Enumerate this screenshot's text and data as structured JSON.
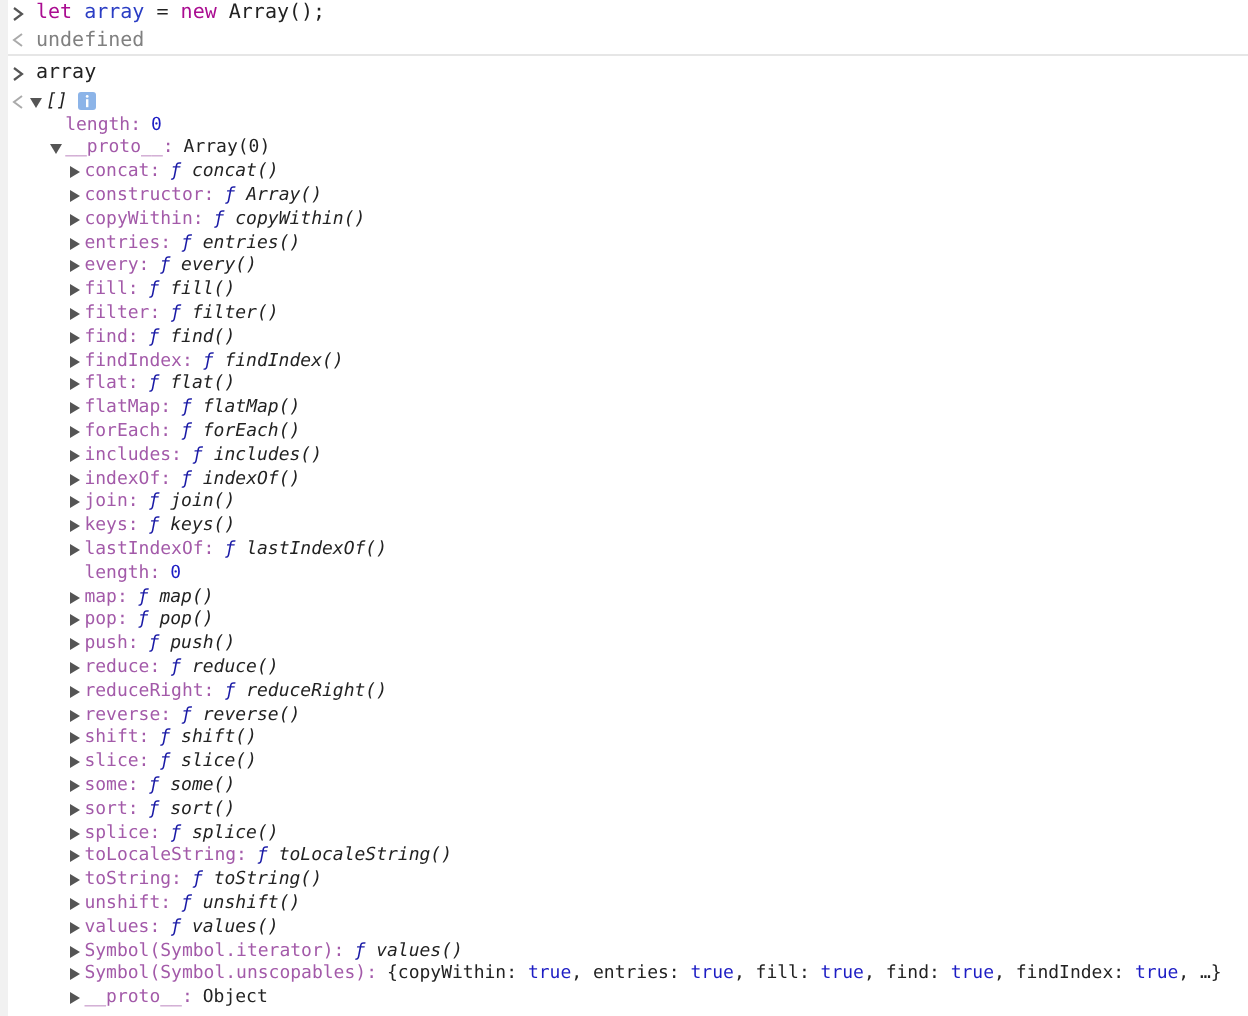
{
  "console": [
    {
      "kind": "input",
      "tokens": [
        {
          "text": "let",
          "kind": "keyword"
        },
        {
          "text": "array",
          "kind": "variable"
        },
        {
          "text": "=",
          "kind": "plain"
        },
        {
          "text": "new",
          "kind": "keyword"
        },
        {
          "text": "Array();",
          "kind": "plain"
        }
      ]
    },
    {
      "kind": "output",
      "text": "undefined"
    },
    {
      "kind": "input",
      "tokens": [
        {
          "text": "array",
          "kind": "plain"
        }
      ]
    },
    {
      "kind": "result",
      "tree": [
        {
          "kind": "array",
          "label": "[]",
          "info": true,
          "expandable": true,
          "expanded": true,
          "children": [
            {
              "key": "length:",
              "kind": "number",
              "value": "0",
              "expandable": false
            },
            {
              "key": "__proto__:",
              "kind": "object",
              "value": "Array(0)",
              "expandable": true,
              "expanded": true,
              "children": [
                {
                  "key": "concat:",
                  "kind": "function",
                  "sign": "ƒ",
                  "value": "concat()",
                  "expandable": true,
                  "expanded": false
                },
                {
                  "key": "constructor:",
                  "kind": "function",
                  "sign": "ƒ",
                  "value": "Array()",
                  "expandable": true,
                  "expanded": false
                },
                {
                  "key": "copyWithin:",
                  "kind": "function",
                  "sign": "ƒ",
                  "value": "copyWithin()",
                  "expandable": true,
                  "expanded": false
                },
                {
                  "key": "entries:",
                  "kind": "function",
                  "sign": "ƒ",
                  "value": "entries()",
                  "expandable": true,
                  "expanded": false
                },
                {
                  "key": "every:",
                  "kind": "function",
                  "sign": "ƒ",
                  "value": "every()",
                  "expandable": true,
                  "expanded": false
                },
                {
                  "key": "fill:",
                  "kind": "function",
                  "sign": "ƒ",
                  "value": "fill()",
                  "expandable": true,
                  "expanded": false
                },
                {
                  "key": "filter:",
                  "kind": "function",
                  "sign": "ƒ",
                  "value": "filter()",
                  "expandable": true,
                  "expanded": false
                },
                {
                  "key": "find:",
                  "kind": "function",
                  "sign": "ƒ",
                  "value": "find()",
                  "expandable": true,
                  "expanded": false
                },
                {
                  "key": "findIndex:",
                  "kind": "function",
                  "sign": "ƒ",
                  "value": "findIndex()",
                  "expandable": true,
                  "expanded": false
                },
                {
                  "key": "flat:",
                  "kind": "function",
                  "sign": "ƒ",
                  "value": "flat()",
                  "expandable": true,
                  "expanded": false
                },
                {
                  "key": "flatMap:",
                  "kind": "function",
                  "sign": "ƒ",
                  "value": "flatMap()",
                  "expandable": true,
                  "expanded": false
                },
                {
                  "key": "forEach:",
                  "kind": "function",
                  "sign": "ƒ",
                  "value": "forEach()",
                  "expandable": true,
                  "expanded": false
                },
                {
                  "key": "includes:",
                  "kind": "function",
                  "sign": "ƒ",
                  "value": "includes()",
                  "expandable": true,
                  "expanded": false
                },
                {
                  "key": "indexOf:",
                  "kind": "function",
                  "sign": "ƒ",
                  "value": "indexOf()",
                  "expandable": true,
                  "expanded": false
                },
                {
                  "key": "join:",
                  "kind": "function",
                  "sign": "ƒ",
                  "value": "join()",
                  "expandable": true,
                  "expanded": false
                },
                {
                  "key": "keys:",
                  "kind": "function",
                  "sign": "ƒ",
                  "value": "keys()",
                  "expandable": true,
                  "expanded": false
                },
                {
                  "key": "lastIndexOf:",
                  "kind": "function",
                  "sign": "ƒ",
                  "value": "lastIndexOf()",
                  "expandable": true,
                  "expanded": false
                },
                {
                  "key": "length:",
                  "kind": "number",
                  "value": "0",
                  "expandable": false
                },
                {
                  "key": "map:",
                  "kind": "function",
                  "sign": "ƒ",
                  "value": "map()",
                  "expandable": true,
                  "expanded": false
                },
                {
                  "key": "pop:",
                  "kind": "function",
                  "sign": "ƒ",
                  "value": "pop()",
                  "expandable": true,
                  "expanded": false
                },
                {
                  "key": "push:",
                  "kind": "function",
                  "sign": "ƒ",
                  "value": "push()",
                  "expandable": true,
                  "expanded": false
                },
                {
                  "key": "reduce:",
                  "kind": "function",
                  "sign": "ƒ",
                  "value": "reduce()",
                  "expandable": true,
                  "expanded": false
                },
                {
                  "key": "reduceRight:",
                  "kind": "function",
                  "sign": "ƒ",
                  "value": "reduceRight()",
                  "expandable": true,
                  "expanded": false
                },
                {
                  "key": "reverse:",
                  "kind": "function",
                  "sign": "ƒ",
                  "value": "reverse()",
                  "expandable": true,
                  "expanded": false
                },
                {
                  "key": "shift:",
                  "kind": "function",
                  "sign": "ƒ",
                  "value": "shift()",
                  "expandable": true,
                  "expanded": false
                },
                {
                  "key": "slice:",
                  "kind": "function",
                  "sign": "ƒ",
                  "value": "slice()",
                  "expandable": true,
                  "expanded": false
                },
                {
                  "key": "some:",
                  "kind": "function",
                  "sign": "ƒ",
                  "value": "some()",
                  "expandable": true,
                  "expanded": false
                },
                {
                  "key": "sort:",
                  "kind": "function",
                  "sign": "ƒ",
                  "value": "sort()",
                  "expandable": true,
                  "expanded": false
                },
                {
                  "key": "splice:",
                  "kind": "function",
                  "sign": "ƒ",
                  "value": "splice()",
                  "expandable": true,
                  "expanded": false
                },
                {
                  "key": "toLocaleString:",
                  "kind": "function",
                  "sign": "ƒ",
                  "value": "toLocaleString()",
                  "expandable": true,
                  "expanded": false
                },
                {
                  "key": "toString:",
                  "kind": "function",
                  "sign": "ƒ",
                  "value": "toString()",
                  "expandable": true,
                  "expanded": false
                },
                {
                  "key": "unshift:",
                  "kind": "function",
                  "sign": "ƒ",
                  "value": "unshift()",
                  "expandable": true,
                  "expanded": false
                },
                {
                  "key": "values:",
                  "kind": "function",
                  "sign": "ƒ",
                  "value": "values()",
                  "expandable": true,
                  "expanded": false
                },
                {
                  "key": "Symbol(Symbol.iterator):",
                  "kind": "function",
                  "sign": "ƒ",
                  "value": "values()",
                  "expandable": true,
                  "expanded": false
                },
                {
                  "key": "Symbol(Symbol.unscopables):",
                  "kind": "preview",
                  "segments": [
                    {
                      "text": "{copyWithin: ",
                      "kind": "plain"
                    },
                    {
                      "text": "true",
                      "kind": "bool"
                    },
                    {
                      "text": ", entries: ",
                      "kind": "plain"
                    },
                    {
                      "text": "true",
                      "kind": "bool"
                    },
                    {
                      "text": ", fill: ",
                      "kind": "plain"
                    },
                    {
                      "text": "true",
                      "kind": "bool"
                    },
                    {
                      "text": ", find: ",
                      "kind": "plain"
                    },
                    {
                      "text": "true",
                      "kind": "bool"
                    },
                    {
                      "text": ", findIndex: ",
                      "kind": "plain"
                    },
                    {
                      "text": "true",
                      "kind": "bool"
                    },
                    {
                      "text": ", …}",
                      "kind": "plain"
                    }
                  ],
                  "expandable": true,
                  "expanded": false
                },
                {
                  "key": "__proto__:",
                  "kind": "object",
                  "value": "Object",
                  "expandable": true,
                  "expanded": false
                }
              ]
            }
          ]
        }
      ]
    }
  ]
}
